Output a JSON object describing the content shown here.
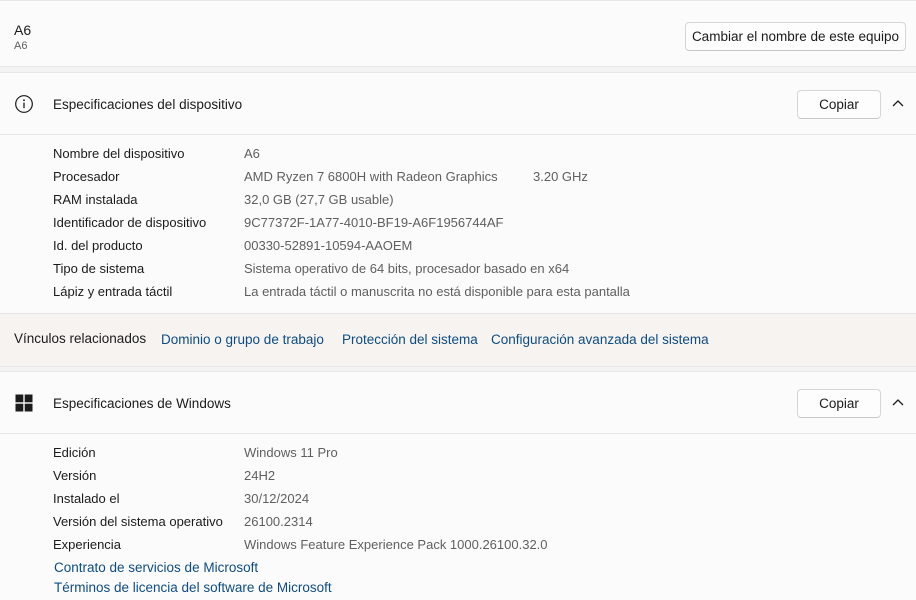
{
  "header": {
    "device_name": "A6",
    "device_subtitle": "A6",
    "rename_button": "Cambiar el nombre de este equipo"
  },
  "device_specs": {
    "title": "Especificaciones del dispositivo",
    "icon": "info-icon",
    "copy_button": "Copiar",
    "rows": [
      {
        "label": "Nombre del dispositivo",
        "value": "A6"
      },
      {
        "label": "Procesador",
        "value": "AMD Ryzen 7 6800H with Radeon Graphics",
        "extra": "3.20 GHz"
      },
      {
        "label": "RAM instalada",
        "value": "32,0 GB (27,7 GB usable)"
      },
      {
        "label": "Identificador de dispositivo",
        "value": "9C77372F-1A77-4010-BF19-A6F1956744AF"
      },
      {
        "label": "Id. del producto",
        "value": "00330-52891-10594-AAOEM"
      },
      {
        "label": "Tipo de sistema",
        "value": "Sistema operativo de 64 bits, procesador basado en x64"
      },
      {
        "label": "Lápiz y entrada táctil",
        "value": "La entrada táctil o manuscrita no está disponible para esta pantalla"
      }
    ]
  },
  "related_links": {
    "label": "Vínculos relacionados",
    "links": [
      "Dominio o grupo de trabajo",
      "Protección del sistema",
      "Configuración avanzada del sistema"
    ]
  },
  "windows_specs": {
    "title": "Especificaciones de Windows",
    "icon": "windows-logo-icon",
    "copy_button": "Copiar",
    "rows": [
      {
        "label": "Edición",
        "value": "Windows 11 Pro"
      },
      {
        "label": "Versión",
        "value": "24H2"
      },
      {
        "label": "Instalado el",
        "value": "30/12/2024"
      },
      {
        "label": "Versión del sistema operativo",
        "value": "26100.2314"
      },
      {
        "label": "Experiencia",
        "value": "Windows Feature Experience Pack 1000.26100.32.0"
      }
    ],
    "links": [
      "Contrato de servicios de Microsoft",
      "Términos de licencia del software de Microsoft"
    ]
  },
  "colors": {
    "link": "#0f4c81",
    "background": "#f3f3f3",
    "card": "#fbfbfb"
  }
}
